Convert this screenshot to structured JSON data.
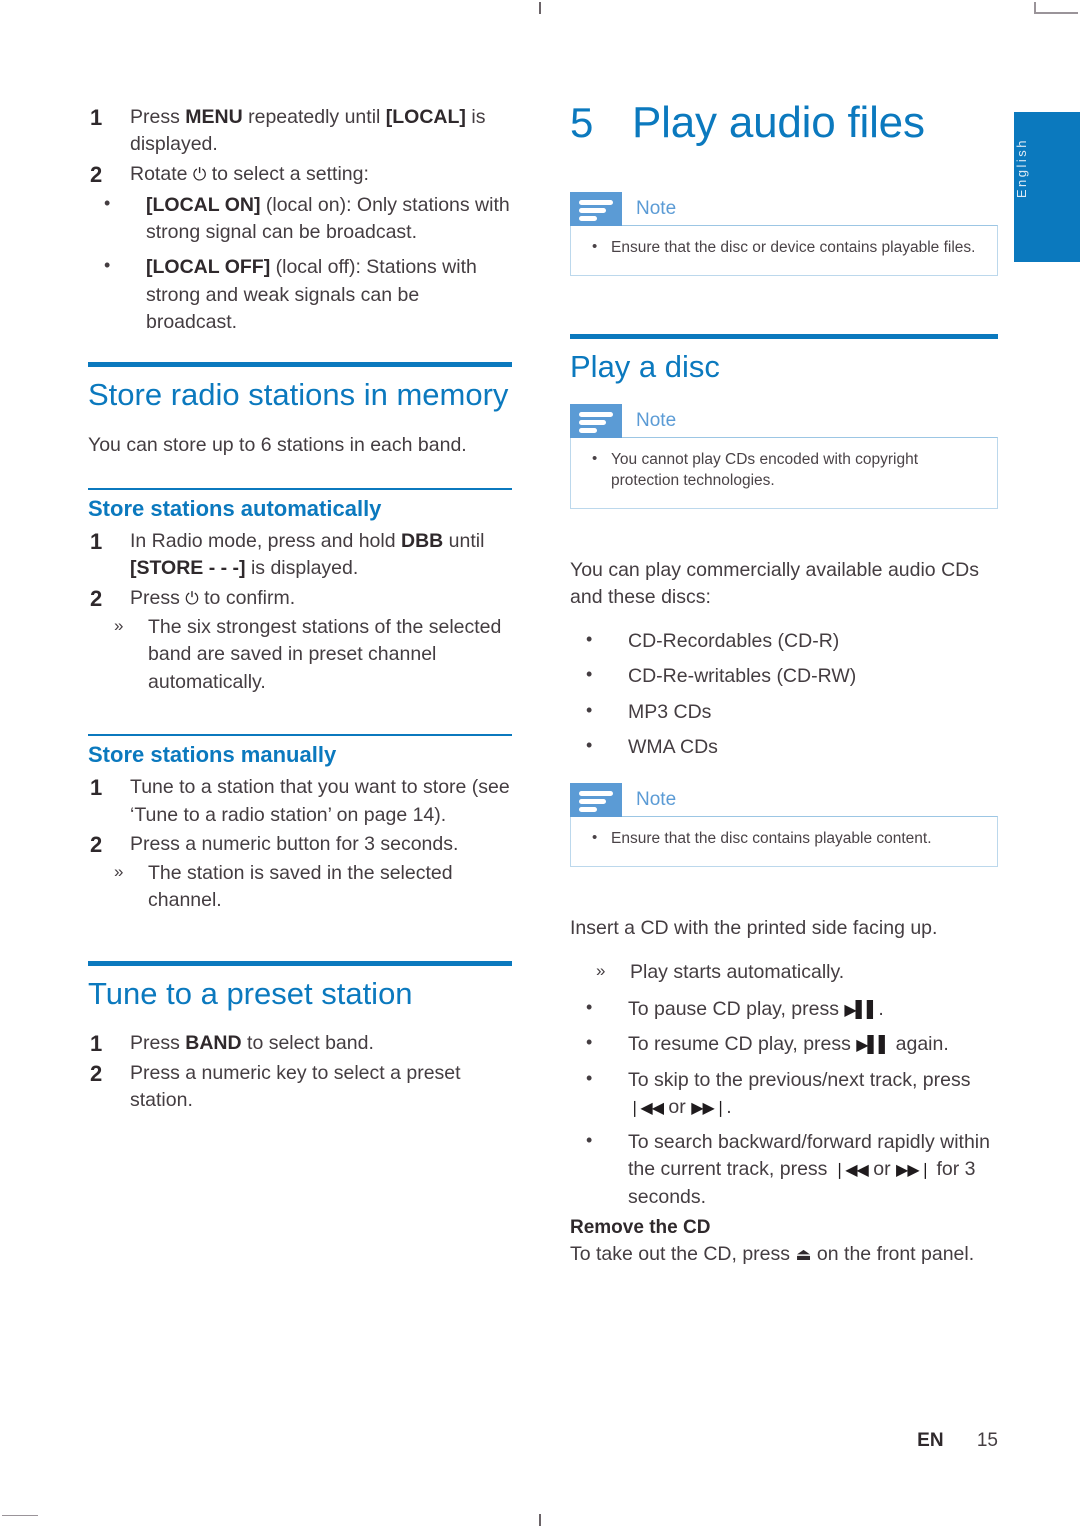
{
  "page": {
    "language_tab": "English",
    "footer_locale": "EN",
    "footer_page": "15"
  },
  "left_column": {
    "steps_local": [
      {
        "num": "1",
        "html": "Press <b>MENU</b> repeatedly until <b>[LOCAL]</b> is displayed."
      },
      {
        "num": "2",
        "html": "Rotate <span class=\"sym\">⏻</span> to select a setting:"
      }
    ],
    "local_options": [
      {
        "html": "<b>[LOCAL ON]</b> (local on): Only stations with strong signal can be broadcast."
      },
      {
        "html": "<b>[LOCAL OFF]</b> (local off): Stations with strong and weak signals can be broadcast."
      }
    ],
    "store_heading": "Store radio stations in memory",
    "store_intro": "You can store up to 6 stations in each band.",
    "auto_heading": "Store stations automatically",
    "auto_steps": [
      {
        "num": "1",
        "html": "In Radio mode, press and hold <b>DBB</b> until <b>[STORE - - -]</b> is displayed."
      },
      {
        "num": "2",
        "html": "Press <span class=\"sym\">⏻</span> to confirm."
      }
    ],
    "auto_result": "The six strongest stations of the selected band are saved in preset channel automatically.",
    "manual_heading": "Store stations manually",
    "manual_steps": [
      {
        "num": "1",
        "html": "Tune to a station that you want to store (see ‘Tune to a radio station’ on page 14)."
      },
      {
        "num": "2",
        "html": "Press a numeric button for 3 seconds."
      }
    ],
    "manual_result": "The station is saved in the selected channel.",
    "preset_heading": "Tune to a preset station",
    "preset_steps": [
      {
        "num": "1",
        "html": "Press <b>BAND</b> to select band."
      },
      {
        "num": "2",
        "html": "Press a numeric key to select a preset station."
      }
    ]
  },
  "right_column": {
    "chapter_number": "5",
    "chapter_title": "Play audio files",
    "note_1": {
      "title": "Note",
      "items": [
        "Ensure that the disc or device contains playable files."
      ]
    },
    "disc_heading": "Play a disc",
    "note_2": {
      "title": "Note",
      "items": [
        "You cannot play CDs encoded with copyright protection technologies."
      ]
    },
    "disc_intro": "You can play commercially available audio CDs and these discs:",
    "disc_types": [
      "CD-Recordables (CD-R)",
      "CD-Re-writables (CD-RW)",
      "MP3 CDs",
      "WMA CDs"
    ],
    "note_3": {
      "title": "Note",
      "items": [
        "Ensure that the disc contains playable content."
      ]
    },
    "insert_text": "Insert a CD with the printed side facing up.",
    "insert_result": "Play starts automatically.",
    "playback_bullets": [
      {
        "html": "To pause CD play, press <span class=\"sym-b\">▶▌▌</span>."
      },
      {
        "html": "To resume CD play, press <span class=\"sym-b\">▶▌▌</span> again."
      },
      {
        "html": "To skip to the previous/next track, press <span class=\"sym-b\">❘◀◀</span> or <span class=\"sym-b\">▶▶❘</span>."
      },
      {
        "html": "To search backward/forward rapidly within the current track, press <span class=\"sym-b\">❘◀◀</span> or <span class=\"sym-b\">▶▶❘</span> for 3 seconds."
      }
    ],
    "remove_heading": "Remove the CD",
    "remove_text_html": "To take out the CD, press <span class=\"sym\">⏏</span> on the front panel."
  },
  "colors": {
    "brand_blue": "#0b79be",
    "note_blue": "#5b9bd5",
    "note_border": "#bcd8ec",
    "body_text": "#443d41"
  }
}
